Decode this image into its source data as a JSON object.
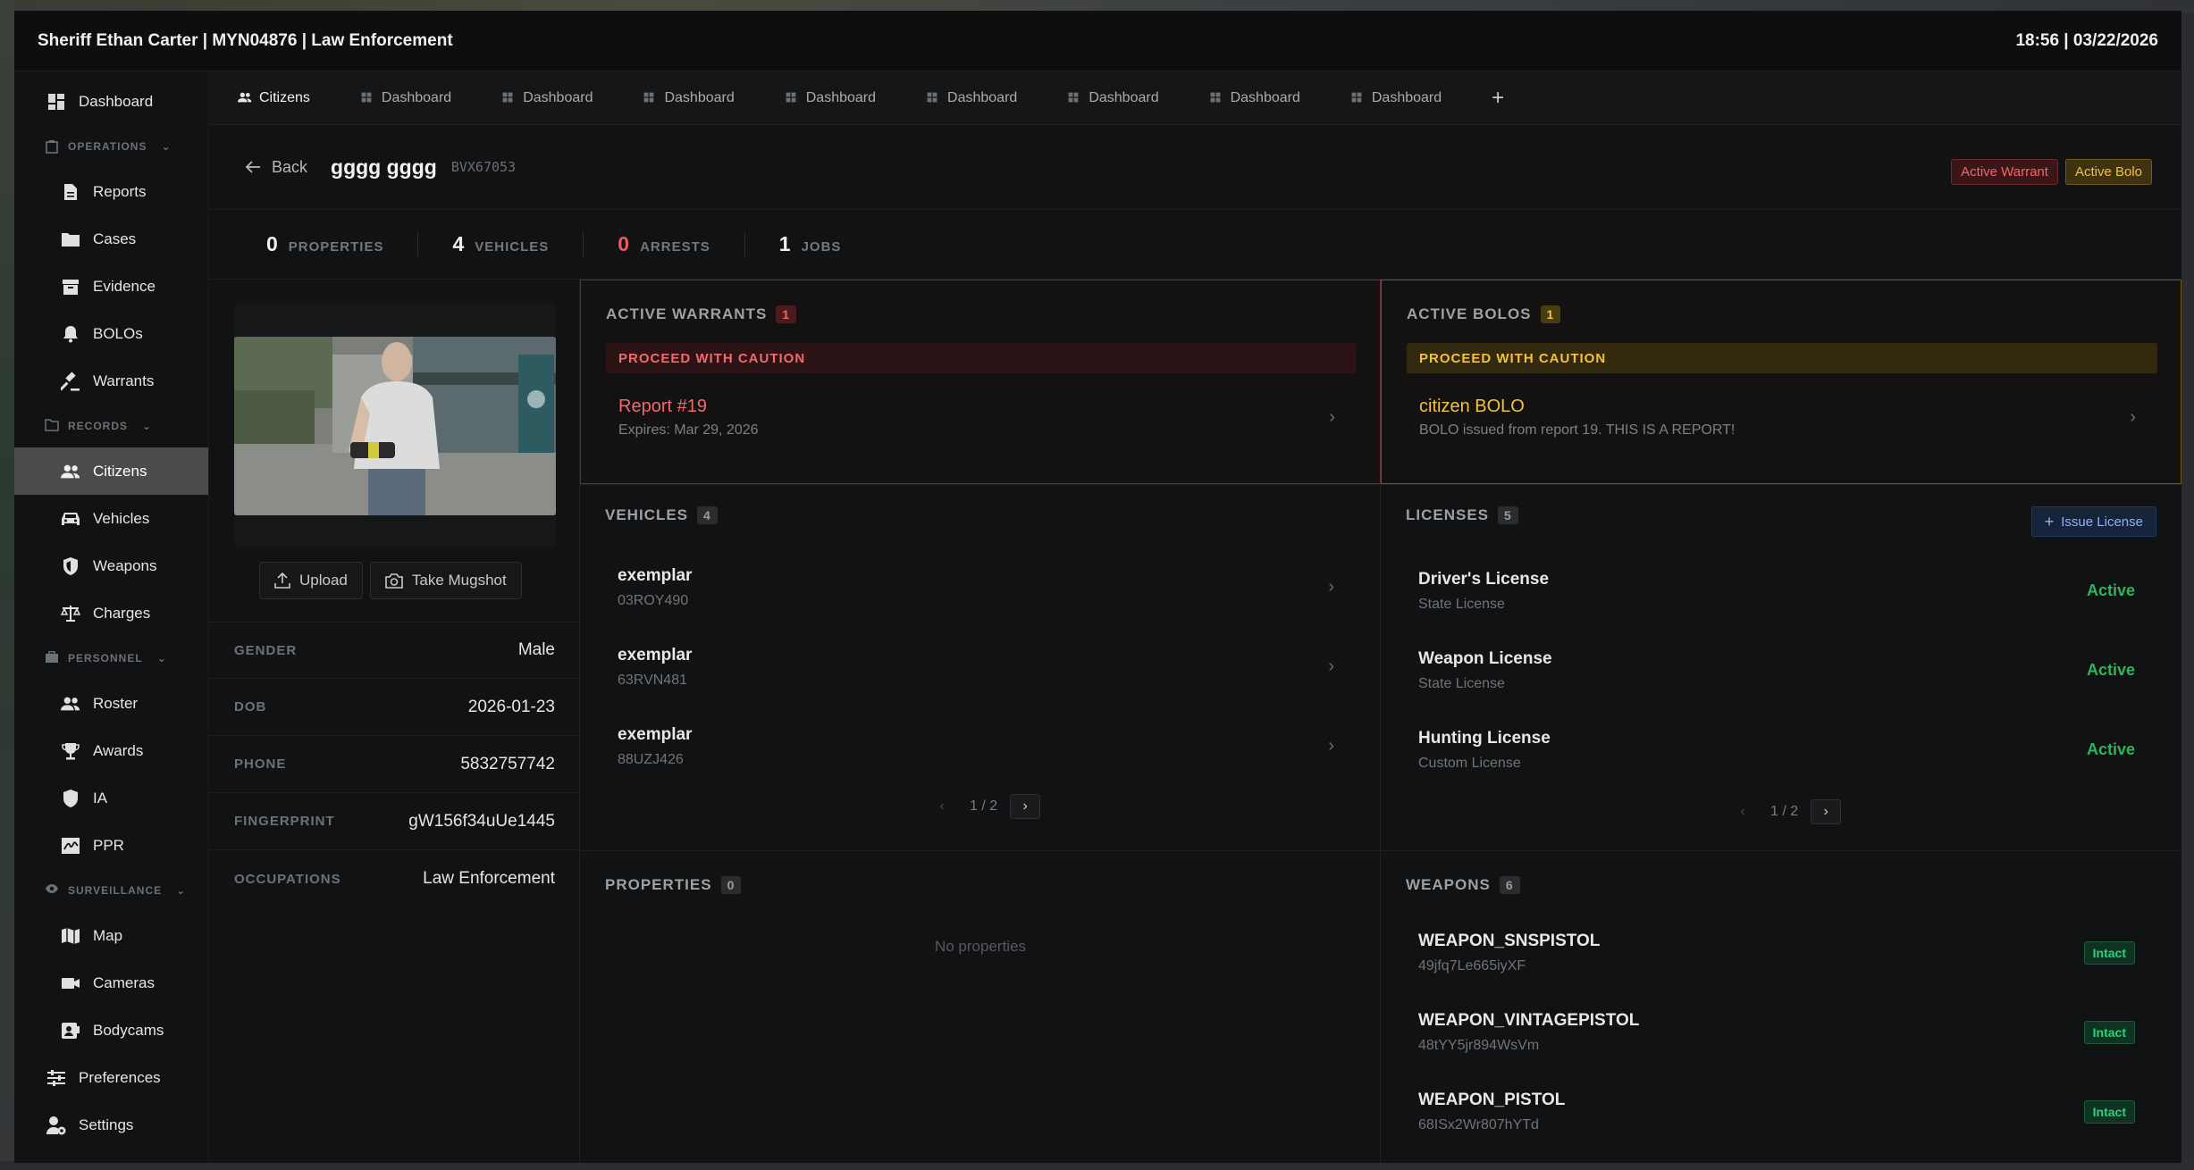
{
  "topbar": {
    "title": "Sheriff Ethan Carter | MYN04876 | Law Enforcement",
    "clock": "18:56 | 03/22/2026"
  },
  "sidebar": {
    "dashboard": "Dashboard",
    "operations": {
      "label": "OPERATIONS",
      "items": [
        "Reports",
        "Cases",
        "Evidence",
        "BOLOs",
        "Warrants"
      ]
    },
    "records": {
      "label": "RECORDS",
      "items": [
        "Citizens",
        "Vehicles",
        "Weapons",
        "Charges"
      ]
    },
    "personnel": {
      "label": "PERSONNEL",
      "items": [
        "Roster",
        "Awards",
        "IA",
        "PPR"
      ]
    },
    "surveillance": {
      "label": "SURVEILLANCE",
      "items": [
        "Map",
        "Cameras",
        "Bodycams"
      ]
    },
    "preferences": "Preferences",
    "settings": "Settings"
  },
  "tabs": [
    "Citizens",
    "Dashboard",
    "Dashboard",
    "Dashboard",
    "Dashboard",
    "Dashboard",
    "Dashboard",
    "Dashboard",
    "Dashboard"
  ],
  "tab_add": "+",
  "header": {
    "back": "Back",
    "name": "gggg gggg",
    "id": "BVX67053",
    "badge_warrant": "Active Warrant",
    "badge_bolo": "Active Bolo"
  },
  "stats": [
    {
      "num": "0",
      "label": "PROPERTIES"
    },
    {
      "num": "4",
      "label": "VEHICLES"
    },
    {
      "num": "0",
      "label": "ARRESTS"
    },
    {
      "num": "1",
      "label": "JOBS"
    }
  ],
  "profile": {
    "upload": "Upload",
    "mugshot": "Take Mugshot",
    "fields": [
      {
        "k": "GENDER",
        "v": "Male"
      },
      {
        "k": "DOB",
        "v": "2026-01-23"
      },
      {
        "k": "PHONE",
        "v": "5832757742"
      },
      {
        "k": "FINGERPRINT",
        "v": "gW156f34uUe1445"
      },
      {
        "k": "OCCUPATIONS",
        "v": "Law Enforcement"
      }
    ]
  },
  "warrants": {
    "title": "ACTIVE WARRANTS",
    "count": "1",
    "caution": "PROCEED WITH CAUTION",
    "entry_title": "Report #19",
    "entry_sub": "Expires: Mar 29, 2026"
  },
  "bolos": {
    "title": "ACTIVE BOLOS",
    "count": "1",
    "caution": "PROCEED WITH CAUTION",
    "entry_title": "citizen BOLO",
    "entry_sub": "BOLO issued from report 19. THIS IS A REPORT!"
  },
  "vehicles": {
    "title": "VEHICLES",
    "count": "4",
    "items": [
      {
        "t": "exemplar",
        "s": "03ROY490"
      },
      {
        "t": "exemplar",
        "s": "63RVN481"
      },
      {
        "t": "exemplar",
        "s": "88UZJ426"
      }
    ],
    "pager": "1 / 2"
  },
  "licenses": {
    "title": "LICENSES",
    "count": "5",
    "issue": "Issue License",
    "items": [
      {
        "t": "Driver's License",
        "s": "State License",
        "status": "Active"
      },
      {
        "t": "Weapon License",
        "s": "State License",
        "status": "Active"
      },
      {
        "t": "Hunting License",
        "s": "Custom License",
        "status": "Active"
      }
    ],
    "pager": "1 / 2"
  },
  "properties": {
    "title": "PROPERTIES",
    "count": "0",
    "empty": "No properties"
  },
  "weapons": {
    "title": "WEAPONS",
    "count": "6",
    "items": [
      {
        "t": "WEAPON_SNSPISTOL",
        "s": "49jfq7Le665iyXF",
        "status": "Intact"
      },
      {
        "t": "WEAPON_VINTAGEPISTOL",
        "s": "48tYY5jr894WsVm",
        "status": "Intact"
      },
      {
        "t": "WEAPON_PISTOL",
        "s": "68ISx2Wr807hYTd",
        "status": "Intact"
      }
    ]
  },
  "colors": {
    "accent_red": "#f05a5c",
    "accent_yellow": "#f2c23a",
    "active_green": "#2fb45a",
    "active_nav": "#4a4b4d"
  }
}
